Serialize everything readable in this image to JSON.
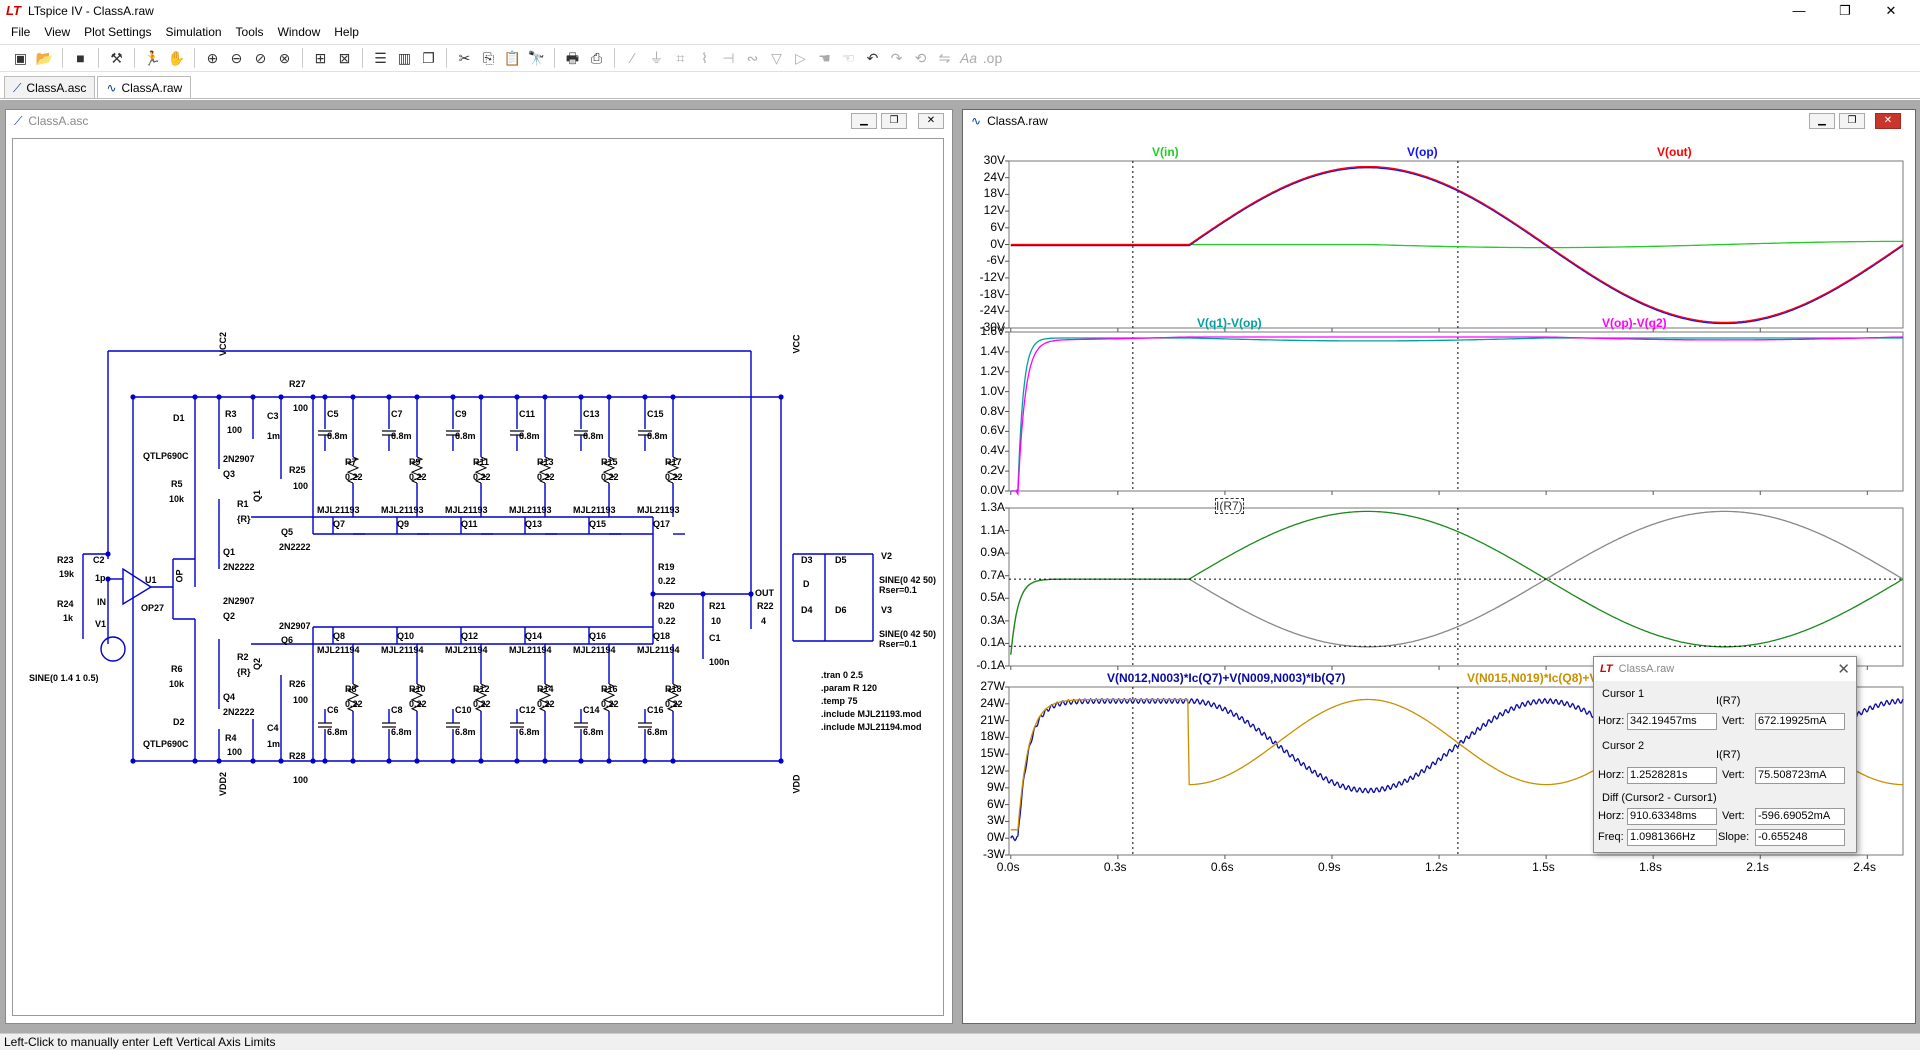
{
  "app": {
    "title": "LTspice IV - ClassA.raw",
    "logo": "LT"
  },
  "window_controls": {
    "minimize": "—",
    "restore": "❐",
    "close": "✕"
  },
  "menu": [
    "File",
    "View",
    "Plot Settings",
    "Simulation",
    "Tools",
    "Window",
    "Help"
  ],
  "toolbar_icons": [
    "new-schematic-icon",
    "open-icon",
    "save-icon",
    "control-panel-icon",
    "run-icon",
    "halt-icon",
    "zoom-in-icon",
    "zoom-out-icon",
    "zoom-back-icon",
    "zoom-fit-icon",
    "autorange-icon",
    "delete-plot-icon",
    "tile-horizontal-icon",
    "tile-vertical-icon",
    "cascade-icon",
    "cut-icon",
    "copy-icon",
    "paste-icon",
    "find-icon",
    "print-preview-icon",
    "print-icon",
    "wire-icon",
    "ground-icon",
    "label-icon",
    "resistor-icon",
    "capacitor-icon",
    "inductor-icon",
    "diode-icon",
    "component-icon",
    "move-icon",
    "drag-icon",
    "undo-icon",
    "redo-icon",
    "rotate-icon",
    "mirror-icon",
    "text-icon",
    "spice-directive-icon"
  ],
  "tabs": [
    {
      "label": "ClassA.asc",
      "icon": "schematic-icon"
    },
    {
      "label": "ClassA.raw",
      "icon": "waveform-icon"
    }
  ],
  "schematic_window": {
    "title": "ClassA.asc",
    "labels": {
      "vcc2": "VCC2",
      "vcc": "VCC",
      "vdd2": "VDD2",
      "vdd": "VDD",
      "r27": "R27",
      "r27v": "100",
      "r28": "R28",
      "r28v": "100",
      "d1": "D1",
      "d1m": "QTLP690C",
      "d2": "D2",
      "d2m": "QTLP690C",
      "r3": "R3",
      "r3v": "100",
      "r4": "R4",
      "r4v": "100",
      "r5": "R5",
      "r5v": "10k",
      "r6": "R6",
      "r6v": "10k",
      "q3": "Q3",
      "q3m": "2N2907",
      "q4": "Q4",
      "q4m": "2N2222",
      "r1": "R1",
      "r1v": "{R}",
      "r2": "R2",
      "r2v": "{R}",
      "q1": "Q1",
      "q1m": "2N2222",
      "q2": "Q2",
      "q2m": "2N2907",
      "q5": "Q5",
      "q5m": "2N2222",
      "q6": "Q6",
      "q6m": "2N2907",
      "c3": "C3",
      "c3v": "1m",
      "c4": "C4",
      "c4v": "1m",
      "r25": "R25",
      "r25v": "100",
      "r26": "R26",
      "r26v": "100",
      "r23": "R23",
      "r23v": "19k",
      "r24": "R24",
      "r24v": "1k",
      "c2": "C2",
      "c2v": "1p",
      "u1": "U1",
      "u1m": "OP27",
      "in": "IN",
      "op": "OP",
      "out": "OUT",
      "q1n": "Q1",
      "q2n": "Q2",
      "v1": "V1",
      "v1v": "SINE(0 1.4 1 0.5)",
      "r19": "R19",
      "r19v": "0.22",
      "r20": "R20",
      "r20v": "0.22",
      "r21": "R21",
      "r21v": "10",
      "c1": "C1",
      "c1v": "100n",
      "r22": "R22",
      "r22v": "4",
      "v2": "V2",
      "v2v": "SINE(0 42 50)",
      "v2r": "Rser=0.1",
      "v3": "V3",
      "v3v": "SINE(0 42 50)",
      "v3r": "Rser=0.1",
      "d3": "D3",
      "d4": "D4",
      "d5": "D5",
      "d6": "D6",
      "dm": "D"
    },
    "top_rs": [
      {
        "r": "R7",
        "v": "0.22",
        "q": "Q7",
        "c": "C5",
        "cv": "6.8m",
        "m": "MJL21193"
      },
      {
        "r": "R9",
        "v": "0.22",
        "q": "Q9",
        "c": "C7",
        "cv": "6.8m",
        "m": "MJL21193"
      },
      {
        "r": "R11",
        "v": "0.22",
        "q": "Q11",
        "c": "C9",
        "cv": "6.8m",
        "m": "MJL21193"
      },
      {
        "r": "R13",
        "v": "0.22",
        "q": "Q13",
        "c": "C11",
        "cv": "6.8m",
        "m": "MJL21193"
      },
      {
        "r": "R15",
        "v": "0.22",
        "q": "Q15",
        "c": "C13",
        "cv": "6.8m",
        "m": "MJL21193"
      },
      {
        "r": "R17",
        "v": "0.22",
        "q": "Q17",
        "c": "C15",
        "cv": "6.8m",
        "m": "MJL21193"
      }
    ],
    "bot_rs": [
      {
        "r": "R8",
        "v": "0.22",
        "q": "Q8",
        "c": "C6",
        "cv": "6.8m",
        "m": "MJL21194"
      },
      {
        "r": "R10",
        "v": "0.22",
        "q": "Q10",
        "c": "C8",
        "cv": "6.8m",
        "m": "MJL21194"
      },
      {
        "r": "R12",
        "v": "0.22",
        "q": "Q12",
        "c": "C10",
        "cv": "6.8m",
        "m": "MJL21194"
      },
      {
        "r": "R14",
        "v": "0.22",
        "q": "Q14",
        "c": "C12",
        "cv": "6.8m",
        "m": "MJL21194"
      },
      {
        "r": "R16",
        "v": "0.22",
        "q": "Q16",
        "c": "C14",
        "cv": "6.8m",
        "m": "MJL21194"
      },
      {
        "r": "R18",
        "v": "0.22",
        "q": "Q18",
        "c": "C16",
        "cv": "6.8m",
        "m": "MJL21194"
      }
    ],
    "directives": [
      ".tran 0 2.5",
      ".param R 120",
      ".temp 75",
      ".include MJL21193.mod",
      ".include MJL21194.mod"
    ]
  },
  "waveform_window": {
    "title": "ClassA.raw",
    "x_ticks": [
      "0.0s",
      "0.3s",
      "0.6s",
      "0.9s",
      "1.2s",
      "1.5s",
      "1.8s",
      "2.1s",
      "2.4s"
    ],
    "pane1": {
      "traces": [
        {
          "name": "V(in)",
          "color": "#22cc22"
        },
        {
          "name": "V(op)",
          "color": "#1010ff"
        },
        {
          "name": "V(out)",
          "color": "#ff0000"
        }
      ],
      "y_ticks": [
        "30V",
        "24V",
        "18V",
        "12V",
        "6V",
        "0V",
        "-6V",
        "-12V",
        "-18V",
        "-24V",
        "-30V"
      ]
    },
    "pane2": {
      "traces": [
        {
          "name": "V(q1)-V(op)",
          "color": "#00a0a0"
        },
        {
          "name": "V(op)-V(q2)",
          "color": "#ff00ff"
        }
      ],
      "y_ticks": [
        "1.6V",
        "1.4V",
        "1.2V",
        "1.0V",
        "0.8V",
        "0.6V",
        "0.4V",
        "0.2V",
        "0.0V"
      ]
    },
    "pane3": {
      "traces": [
        {
          "name": "I(R7)",
          "color": "#1a8a1a"
        }
      ],
      "y_ticks": [
        "1.3A",
        "1.1A",
        "0.9A",
        "0.7A",
        "0.5A",
        "0.3A",
        "0.1A",
        "-0.1A"
      ]
    },
    "pane4": {
      "traces": [
        {
          "name": "V(N012,N003)*Ic(Q7)+V(N009,N003)*Ib(Q7)",
          "color": "#0a0aa0"
        },
        {
          "name": "V(N015,N019)*Ic(Q8)+V(N018,N019)*Ib(Q8)",
          "color": "#c89000"
        }
      ],
      "y_ticks": [
        "27W",
        "24W",
        "21W",
        "18W",
        "15W",
        "12W",
        "9W",
        "6W",
        "3W",
        "0W",
        "-3W"
      ]
    }
  },
  "cursor_dialog": {
    "title": "ClassA.raw",
    "cursor1_label": "Cursor 1",
    "cursor1_trace": "I(R7)",
    "cursor1_horz": "342.19457ms",
    "cursor1_vert": "672.19925mA",
    "cursor2_label": "Cursor 2",
    "cursor2_trace": "I(R7)",
    "cursor2_horz": "1.2528281s",
    "cursor2_vert": "75.508723mA",
    "diff_label": "Diff (Cursor2 - Cursor1)",
    "diff_horz": "910.63348ms",
    "diff_vert": "-596.69052mA",
    "freq": "1.0981366Hz",
    "slope": "-0.655248",
    "horz_label": "Horz:",
    "vert_label": "Vert:",
    "freq_label": "Freq:",
    "slope_label": "Slope:"
  },
  "status": "Left-Click to manually enter Left Vertical Axis Limits"
}
